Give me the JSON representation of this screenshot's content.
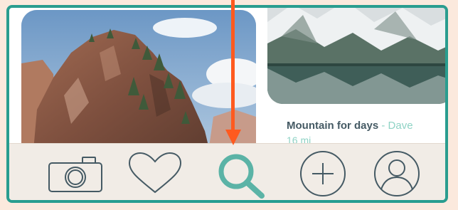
{
  "feed": {
    "cards": [
      {
        "title": "Mountain for days",
        "separator": " - ",
        "author": "Dave",
        "distance": "16 mi"
      }
    ]
  },
  "tabbar": {
    "tabs": [
      {
        "icon": "camera-icon"
      },
      {
        "icon": "heart-icon"
      },
      {
        "icon": "search-icon",
        "active": true
      },
      {
        "icon": "plus-circle-icon"
      },
      {
        "icon": "profile-icon"
      }
    ]
  },
  "colors": {
    "frame": "#2a9d8f",
    "accent": "#5bb3a6",
    "icon": "#455a64",
    "tabbar_bg": "#f1ece6",
    "background": "#fbe9dd",
    "annotation_arrow": "#ff5a1f"
  }
}
